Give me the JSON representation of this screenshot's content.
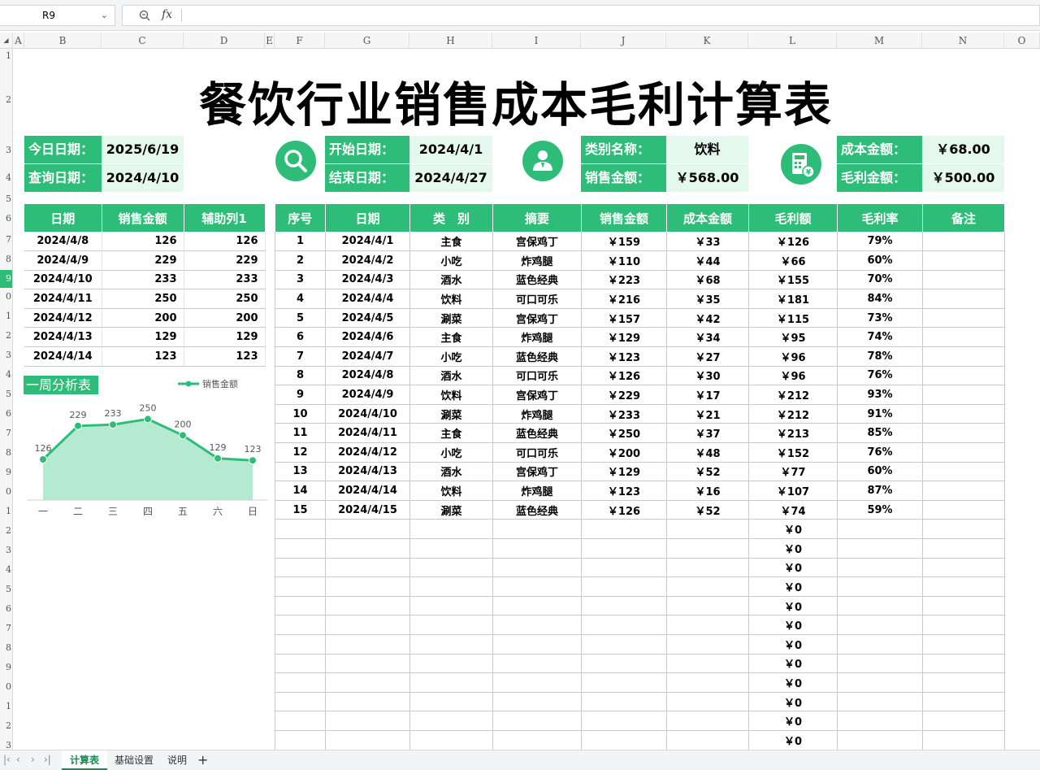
{
  "namebox": {
    "cell": "R9",
    "fx": "fx"
  },
  "columns": [
    "A",
    "B",
    "C",
    "D",
    "E",
    "F",
    "G",
    "H",
    "I",
    "J",
    "K",
    "L",
    "M",
    "N",
    "O"
  ],
  "rows": [
    "1",
    "2",
    "3",
    "4",
    "5",
    "6",
    "7",
    "8",
    "9",
    "0",
    "1",
    "2",
    "3",
    "4",
    "5",
    "6",
    "7",
    "8",
    "9",
    "0",
    "1",
    "2",
    "3",
    "4",
    "5",
    "6",
    "7",
    "8",
    "9",
    "0",
    "1",
    "2",
    "3"
  ],
  "title": "餐饮行业销售成本毛利计算表",
  "info": {
    "today_label": "今日日期：",
    "today_value": "2025/6/19",
    "query_label": "查询日期：",
    "query_value": "2024/4/10",
    "start_label": "开始日期：",
    "start_value": "2024/4/1",
    "end_label": "结束日期：",
    "end_value": "2024/4/27",
    "category_label": "类别名称：",
    "category_value": "饮料",
    "sales_label": "销售金额：",
    "sales_value": "￥568.00",
    "cost_label": "成本金额：",
    "cost_value": "￥68.00",
    "profit_label": "毛利金额：",
    "profit_value": "￥500.00"
  },
  "left_table": {
    "headers": [
      "日期",
      "销售金额",
      "辅助列1"
    ],
    "rows": [
      [
        "2024/4/8",
        "126",
        "126"
      ],
      [
        "2024/4/9",
        "229",
        "229"
      ],
      [
        "2024/4/10",
        "233",
        "233"
      ],
      [
        "2024/4/11",
        "250",
        "250"
      ],
      [
        "2024/4/12",
        "200",
        "200"
      ],
      [
        "2024/4/13",
        "129",
        "129"
      ],
      [
        "2024/4/14",
        "123",
        "123"
      ]
    ]
  },
  "chart_title": "一周分析表",
  "chart_data": {
    "type": "area",
    "categories": [
      "一",
      "二",
      "三",
      "四",
      "五",
      "六",
      "日"
    ],
    "series": [
      {
        "name": "销售金额",
        "values": [
          126,
          229,
          233,
          250,
          200,
          129,
          123
        ]
      }
    ],
    "legend": "top-right",
    "color": "#2ebd78",
    "fill": "#b3ead0",
    "ylim": [
      0,
      300
    ]
  },
  "main_table": {
    "headers": [
      "序号",
      "日期",
      "类　别",
      "摘要",
      "销售金额",
      "成本金额",
      "毛利额",
      "毛利率",
      "备注"
    ],
    "rows": [
      [
        "1",
        "2024/4/1",
        "主食",
        "宫保鸡丁",
        "￥159",
        "￥33",
        "￥126",
        "79%",
        ""
      ],
      [
        "2",
        "2024/4/2",
        "小吃",
        "炸鸡腿",
        "￥110",
        "￥44",
        "￥66",
        "60%",
        ""
      ],
      [
        "3",
        "2024/4/3",
        "酒水",
        "蓝色经典",
        "￥223",
        "￥68",
        "￥155",
        "70%",
        ""
      ],
      [
        "4",
        "2024/4/4",
        "饮料",
        "可口可乐",
        "￥216",
        "￥35",
        "￥181",
        "84%",
        ""
      ],
      [
        "5",
        "2024/4/5",
        "涮菜",
        "宫保鸡丁",
        "￥157",
        "￥42",
        "￥115",
        "73%",
        ""
      ],
      [
        "6",
        "2024/4/6",
        "主食",
        "炸鸡腿",
        "￥129",
        "￥34",
        "￥95",
        "74%",
        ""
      ],
      [
        "7",
        "2024/4/7",
        "小吃",
        "蓝色经典",
        "￥123",
        "￥27",
        "￥96",
        "78%",
        ""
      ],
      [
        "8",
        "2024/4/8",
        "酒水",
        "可口可乐",
        "￥126",
        "￥30",
        "￥96",
        "76%",
        ""
      ],
      [
        "9",
        "2024/4/9",
        "饮料",
        "宫保鸡丁",
        "￥229",
        "￥17",
        "￥212",
        "93%",
        ""
      ],
      [
        "10",
        "2024/4/10",
        "涮菜",
        "炸鸡腿",
        "￥233",
        "￥21",
        "￥212",
        "91%",
        ""
      ],
      [
        "11",
        "2024/4/11",
        "主食",
        "蓝色经典",
        "￥250",
        "￥37",
        "￥213",
        "85%",
        ""
      ],
      [
        "12",
        "2024/4/12",
        "小吃",
        "可口可乐",
        "￥200",
        "￥48",
        "￥152",
        "76%",
        ""
      ],
      [
        "13",
        "2024/4/13",
        "酒水",
        "宫保鸡丁",
        "￥129",
        "￥52",
        "￥77",
        "60%",
        ""
      ],
      [
        "14",
        "2024/4/14",
        "饮料",
        "炸鸡腿",
        "￥123",
        "￥16",
        "￥107",
        "87%",
        ""
      ],
      [
        "15",
        "2024/4/15",
        "涮菜",
        "蓝色经典",
        "￥126",
        "￥52",
        "￥74",
        "59%",
        ""
      ],
      [
        "",
        "",
        "",
        "",
        "",
        "",
        "￥0",
        "",
        ""
      ],
      [
        "",
        "",
        "",
        "",
        "",
        "",
        "￥0",
        "",
        ""
      ],
      [
        "",
        "",
        "",
        "",
        "",
        "",
        "￥0",
        "",
        ""
      ],
      [
        "",
        "",
        "",
        "",
        "",
        "",
        "￥0",
        "",
        ""
      ],
      [
        "",
        "",
        "",
        "",
        "",
        "",
        "￥0",
        "",
        ""
      ],
      [
        "",
        "",
        "",
        "",
        "",
        "",
        "￥0",
        "",
        ""
      ],
      [
        "",
        "",
        "",
        "",
        "",
        "",
        "￥0",
        "",
        ""
      ],
      [
        "",
        "",
        "",
        "",
        "",
        "",
        "￥0",
        "",
        ""
      ],
      [
        "",
        "",
        "",
        "",
        "",
        "",
        "￥0",
        "",
        ""
      ],
      [
        "",
        "",
        "",
        "",
        "",
        "",
        "￥0",
        "",
        ""
      ],
      [
        "",
        "",
        "",
        "",
        "",
        "",
        "￥0",
        "",
        ""
      ],
      [
        "",
        "",
        "",
        "",
        "",
        "",
        "￥0",
        "",
        ""
      ]
    ]
  },
  "sheets": {
    "tabs": [
      "计算表",
      "基础设置",
      "说明"
    ],
    "active": "计算表",
    "add": "+"
  },
  "icons": {
    "search": "search-icon",
    "person": "person-icon",
    "calculator": "calculator-icon"
  }
}
